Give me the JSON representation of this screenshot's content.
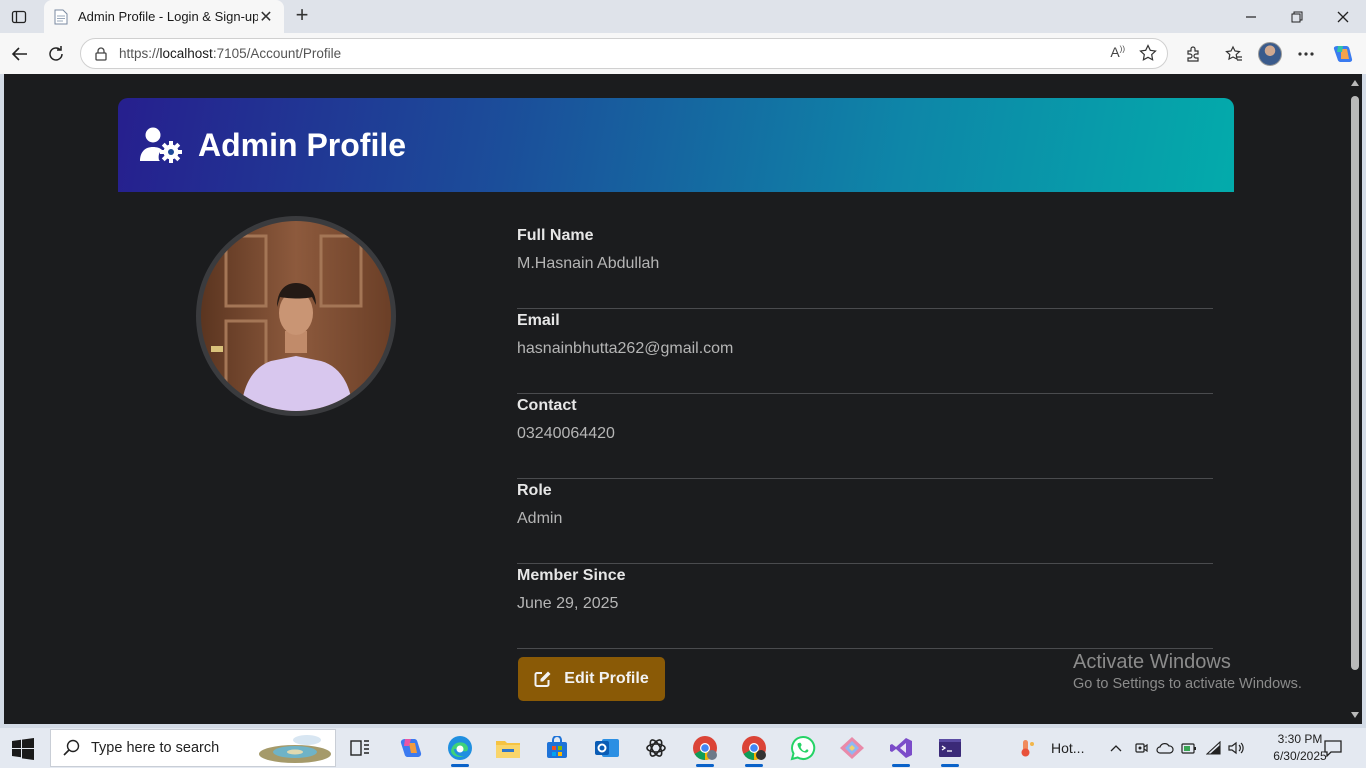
{
  "browser": {
    "tab_title": "Admin Profile - Login & Sign-up",
    "url_prefix": "https://",
    "url_host": "localhost",
    "url_rest": ":7105/Account/Profile"
  },
  "page": {
    "title": "Admin Profile",
    "fields": [
      {
        "label": "Full Name",
        "value": "M.Hasnain Abdullah"
      },
      {
        "label": "Email",
        "value": "hasnainbhutta262@gmail.com"
      },
      {
        "label": "Contact",
        "value": "03240064420"
      },
      {
        "label": "Role",
        "value": "Admin"
      },
      {
        "label": "Member Since",
        "value": "June 29, 2025"
      }
    ],
    "edit_button": "Edit Profile"
  },
  "watermark": {
    "line1": "Activate Windows",
    "line2": "Go to Settings to activate Windows."
  },
  "taskbar": {
    "search_placeholder": "Type here to search",
    "weather": "Hot...",
    "time": "3:30 PM",
    "date": "6/30/2025"
  },
  "colors": {
    "page_bg": "#1b1c1e",
    "header_start": "#261f8e",
    "header_end": "#03abab",
    "button": "#8a5a06"
  }
}
